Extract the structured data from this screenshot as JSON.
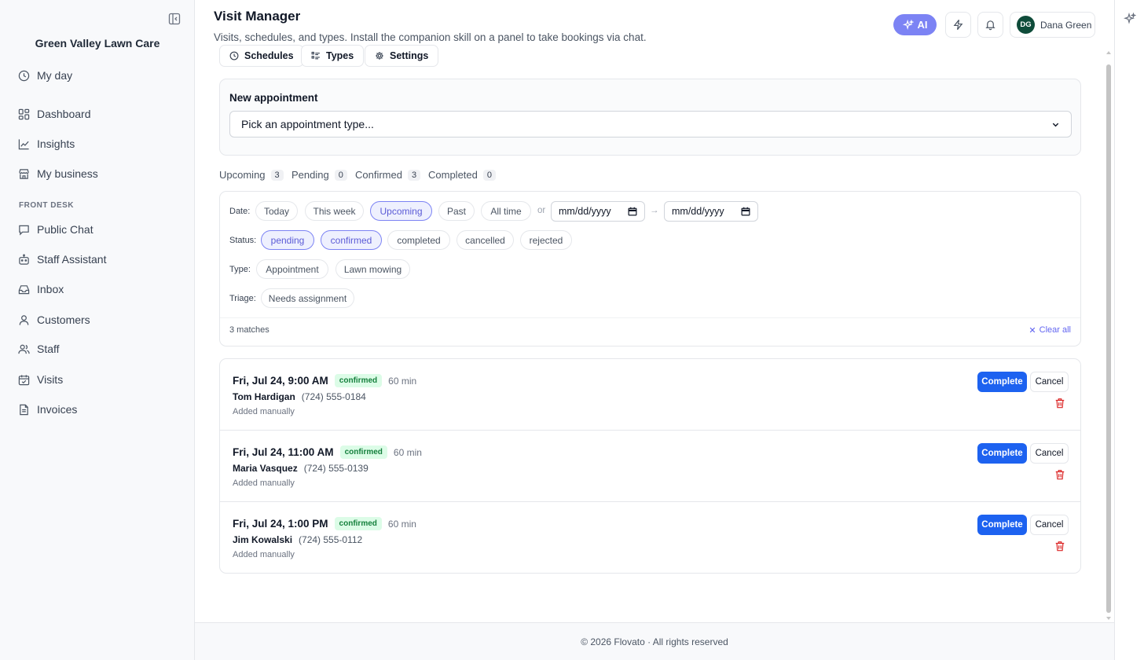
{
  "sidebar": {
    "brand": "Green Valley Lawn Care",
    "items_top": [
      {
        "label": "My day",
        "icon": "clock-icon"
      },
      {
        "label": "Dashboard",
        "icon": "dashboard-icon"
      },
      {
        "label": "Insights",
        "icon": "chart-line-icon"
      },
      {
        "label": "My business",
        "icon": "store-icon"
      }
    ],
    "section": "FRONT DESK",
    "items_front": [
      {
        "label": "Public Chat",
        "icon": "chat-icon"
      },
      {
        "label": "Staff Assistant",
        "icon": "bot-icon"
      },
      {
        "label": "Inbox",
        "icon": "inbox-icon"
      },
      {
        "label": "Customers",
        "icon": "user-icon"
      },
      {
        "label": "Staff",
        "icon": "users-icon"
      },
      {
        "label": "Visits",
        "icon": "calendar-check-icon"
      },
      {
        "label": "Invoices",
        "icon": "document-icon"
      }
    ]
  },
  "header": {
    "title": "Visit Manager",
    "subtitle": "Visits, schedules, and types. Install the companion skill on a panel to take bookings via chat.",
    "ai_label": "AI",
    "user_initials": "DG",
    "user_name": "Dana Green",
    "accent": "#7c83f4"
  },
  "subnav": [
    {
      "label": "Schedules",
      "icon": "clock-icon"
    },
    {
      "label": "Types",
      "icon": "list-icon"
    },
    {
      "label": "Settings",
      "icon": "gear-icon"
    }
  ],
  "new_appointment": {
    "title": "New appointment",
    "placeholder": "Pick an appointment type..."
  },
  "tabs": [
    {
      "label": "Upcoming",
      "count": "3"
    },
    {
      "label": "Pending",
      "count": "0"
    },
    {
      "label": "Confirmed",
      "count": "3"
    },
    {
      "label": "Completed",
      "count": "0"
    }
  ],
  "filters": {
    "date_label": "Date:",
    "date_options": [
      "Today",
      "This week",
      "Upcoming",
      "Past",
      "All time"
    ],
    "date_active": "Upcoming",
    "or": "or",
    "arrow": "→",
    "date_from": "mm/dd/yyyy",
    "date_to": "mm/dd/yyyy",
    "status_label": "Status:",
    "status_options": [
      "pending",
      "confirmed",
      "completed",
      "cancelled",
      "rejected"
    ],
    "status_active": [
      "pending",
      "confirmed"
    ],
    "type_label": "Type:",
    "type_options": [
      "Appointment",
      "Lawn mowing"
    ],
    "triage_label": "Triage:",
    "triage_options": [
      "Needs assignment"
    ],
    "matches": "3 matches",
    "clear_all": "Clear all"
  },
  "appointments": [
    {
      "when": "Fri, Jul 24, 9:00 AM",
      "status": "confirmed",
      "duration": "60 min",
      "name": "Tom Hardigan",
      "phone": "(724) 555-0184",
      "source": "Added manually",
      "complete_label": "Complete",
      "cancel_label": "Cancel"
    },
    {
      "when": "Fri, Jul 24, 11:00 AM",
      "status": "confirmed",
      "duration": "60 min",
      "name": "Maria Vasquez",
      "phone": "(724) 555-0139",
      "source": "Added manually",
      "complete_label": "Complete",
      "cancel_label": "Cancel"
    },
    {
      "when": "Fri, Jul 24, 1:00 PM",
      "status": "confirmed",
      "duration": "60 min",
      "name": "Jim Kowalski",
      "phone": "(724) 555-0112",
      "source": "Added manually",
      "complete_label": "Complete",
      "cancel_label": "Cancel"
    }
  ],
  "footer": "© 2026 Flovato · All rights reserved"
}
